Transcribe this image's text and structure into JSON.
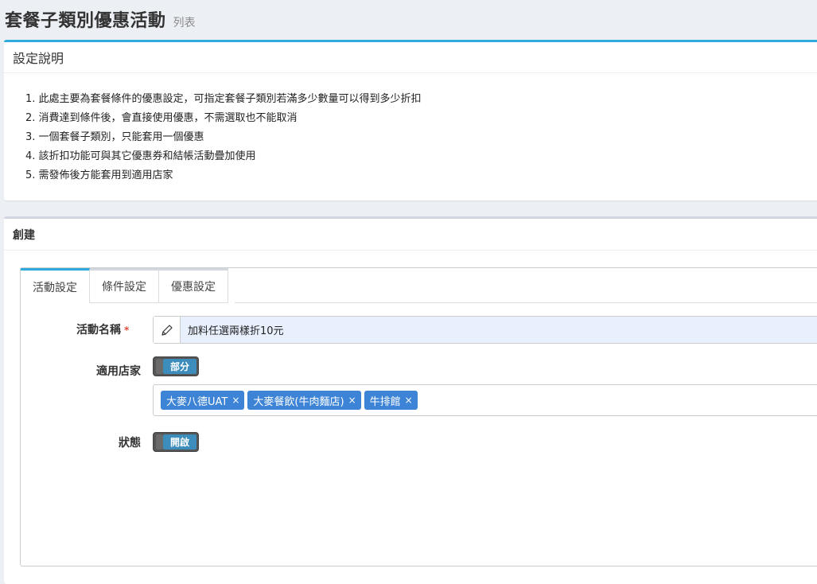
{
  "header": {
    "title": "套餐子類別優惠活動",
    "subtitle": "列表"
  },
  "info_box": {
    "title": "設定說明",
    "items": [
      "1. 此處主要為套餐條件的優惠設定，可指定套餐子類別若滿多少數量可以得到多少折扣",
      "2. 消費達到條件後，會直接使用優惠，不需選取也不能取消",
      "3. 一個套餐子類別，只能套用一個優惠",
      "4. 該折扣功能可與其它優惠券和結帳活動疊加使用",
      "5. 需發佈後方能套用到適用店家"
    ]
  },
  "create_box": {
    "title": "創建",
    "tabs": [
      {
        "label": "活動設定",
        "active": true
      },
      {
        "label": "條件設定",
        "active": false
      },
      {
        "label": "優惠設定",
        "active": false
      }
    ],
    "form": {
      "name_label": "活動名稱",
      "required_mark": "*",
      "name_value": "加料任選兩樣折10元",
      "stores_label": "適用店家",
      "stores_switch": "部分",
      "store_tags": [
        "大麥八德UAT",
        "大麥餐飲(牛肉麵店)",
        "牛排館"
      ],
      "tag_remove": "×",
      "status_label": "狀態",
      "status_switch": "開啟"
    }
  },
  "colors": {
    "accent": "#2eaadc",
    "switch_on": "#3c8dbc",
    "tag": "#3d84d6",
    "required": "#dd4b39"
  },
  "icons": {
    "name_addon": "pencil-icon"
  }
}
